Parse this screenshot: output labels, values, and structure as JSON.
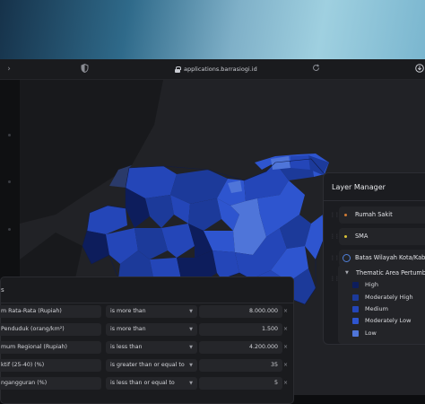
{
  "browser": {
    "url": "applications.barrasiogi.id"
  },
  "layer_manager": {
    "title": "Layer Manager",
    "layers": [
      {
        "label": "Rumah Sakit",
        "marker_color": "#d07a34"
      },
      {
        "label": "SMA",
        "marker_color": "#d9c237"
      },
      {
        "label": "Batas Wilayah Kota/Kabupa",
        "marker_color": "#4f7fd9"
      }
    ],
    "thematic": {
      "title": "Thematic Area Pertumbuh",
      "legend": [
        {
          "label": "High",
          "color": "#0d1d5c"
        },
        {
          "label": "Moderately High",
          "color": "#1c3a9a"
        },
        {
          "label": "Medium",
          "color": "#2446b8"
        },
        {
          "label": "Moderately Low",
          "color": "#2e55cf"
        },
        {
          "label": "Low",
          "color": "#4f75d9"
        }
      ]
    }
  },
  "filter_panel": {
    "corner_text": "s",
    "rows": [
      {
        "field": "m Rata-Rata (Rupiah)",
        "operator": "is more than",
        "value": "8.000.000"
      },
      {
        "field": "Penduduk (orang/km²)",
        "operator": "is more than",
        "value": "1.500"
      },
      {
        "field": "mum Regional (Rupiah)",
        "operator": "is less than",
        "value": "4.200.000"
      },
      {
        "field": "ktif (25-40) (%)",
        "operator": "is greater than or equal to",
        "value": "35"
      },
      {
        "field": "ngangguran (%)",
        "operator": "is less than or equal to",
        "value": "5"
      }
    ]
  }
}
